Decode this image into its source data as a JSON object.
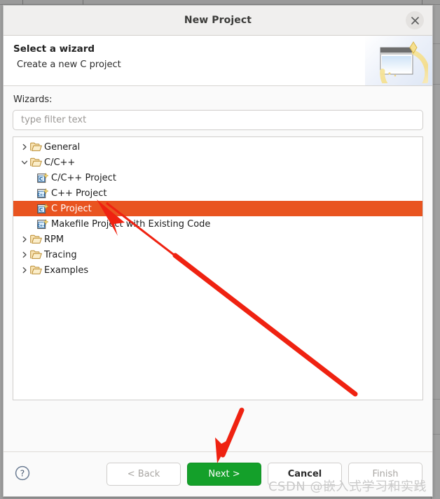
{
  "window": {
    "title": "New Project",
    "close_icon": "close-icon"
  },
  "header": {
    "title": "Select a wizard",
    "subtitle": "Create a new C project",
    "banner_icon": "wizard-banner-icon"
  },
  "form": {
    "wizards_label": "Wizards:",
    "filter_placeholder": "type filter text",
    "filter_value": ""
  },
  "tree": [
    {
      "label": "General",
      "level": 0,
      "type": "folder",
      "state": "collapsed",
      "selected": false
    },
    {
      "label": "C/C++",
      "level": 0,
      "type": "folder",
      "state": "expanded",
      "selected": false
    },
    {
      "label": "C/C++ Project",
      "level": 1,
      "type": "c-project",
      "state": "leaf",
      "selected": false
    },
    {
      "label": "C++ Project",
      "level": 1,
      "type": "cpp-project",
      "state": "leaf",
      "selected": false
    },
    {
      "label": "C Project",
      "level": 1,
      "type": "c-project",
      "state": "leaf",
      "selected": true
    },
    {
      "label": "Makefile Project with Existing Code",
      "level": 1,
      "type": "cpp-project",
      "state": "leaf",
      "selected": false
    },
    {
      "label": "RPM",
      "level": 0,
      "type": "folder",
      "state": "collapsed",
      "selected": false
    },
    {
      "label": "Tracing",
      "level": 0,
      "type": "folder",
      "state": "collapsed",
      "selected": false
    },
    {
      "label": "Examples",
      "level": 0,
      "type": "folder",
      "state": "collapsed",
      "selected": false
    }
  ],
  "footer": {
    "help_icon": "help-icon",
    "buttons": [
      {
        "label": "< Back",
        "state": "disabled",
        "style": "default"
      },
      {
        "label": "Next >",
        "state": "enabled",
        "style": "primary"
      },
      {
        "label": "Cancel",
        "state": "enabled",
        "style": "default"
      },
      {
        "label": "Finish",
        "state": "disabled",
        "style": "default"
      }
    ]
  },
  "annotations": {
    "arrow_to_tree_item": "red-arrow-icon",
    "arrow_to_next_button": "red-arrow-icon",
    "arrow_color": "#ef2211"
  },
  "watermark": {
    "text": "CSDN @嵌入式学习和实践"
  },
  "colors": {
    "selection": "#e95420",
    "primary_button": "#14a02a",
    "annotation_red": "#ef2211"
  }
}
